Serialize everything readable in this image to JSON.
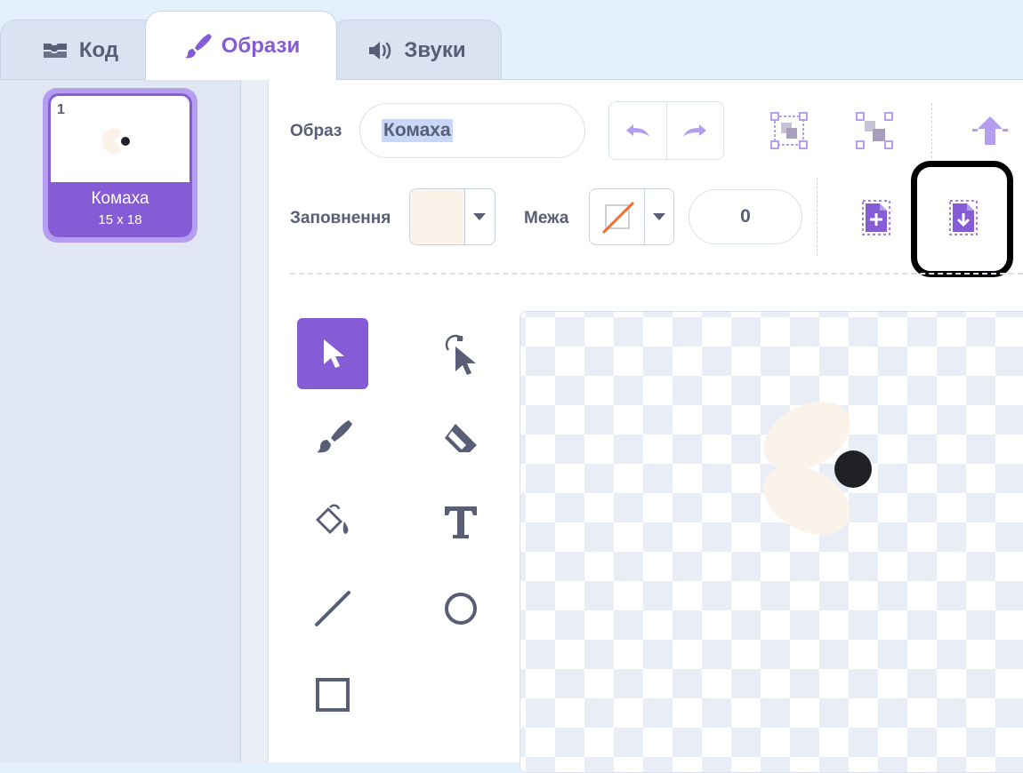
{
  "tabs": [
    {
      "label": "Код",
      "icon": "code-blocks-icon"
    },
    {
      "label": "Образи",
      "icon": "paintbrush-icon"
    },
    {
      "label": "Звуки",
      "icon": "speaker-icon"
    }
  ],
  "costume_list": {
    "items": [
      {
        "number": "1",
        "name": "Комаха",
        "size": "15 x 18"
      }
    ]
  },
  "toolbar": {
    "costume_label": "Образ",
    "costume_name": "Комаха",
    "fill_label": "Заповнення",
    "fill_color": "#fbf3e9",
    "outline_label": "Межа",
    "outline_value": "0"
  },
  "colors": {
    "accent": "#855cd6",
    "accent_light": "#b59ef0",
    "text": "#575e75",
    "highlight": "#000000"
  }
}
